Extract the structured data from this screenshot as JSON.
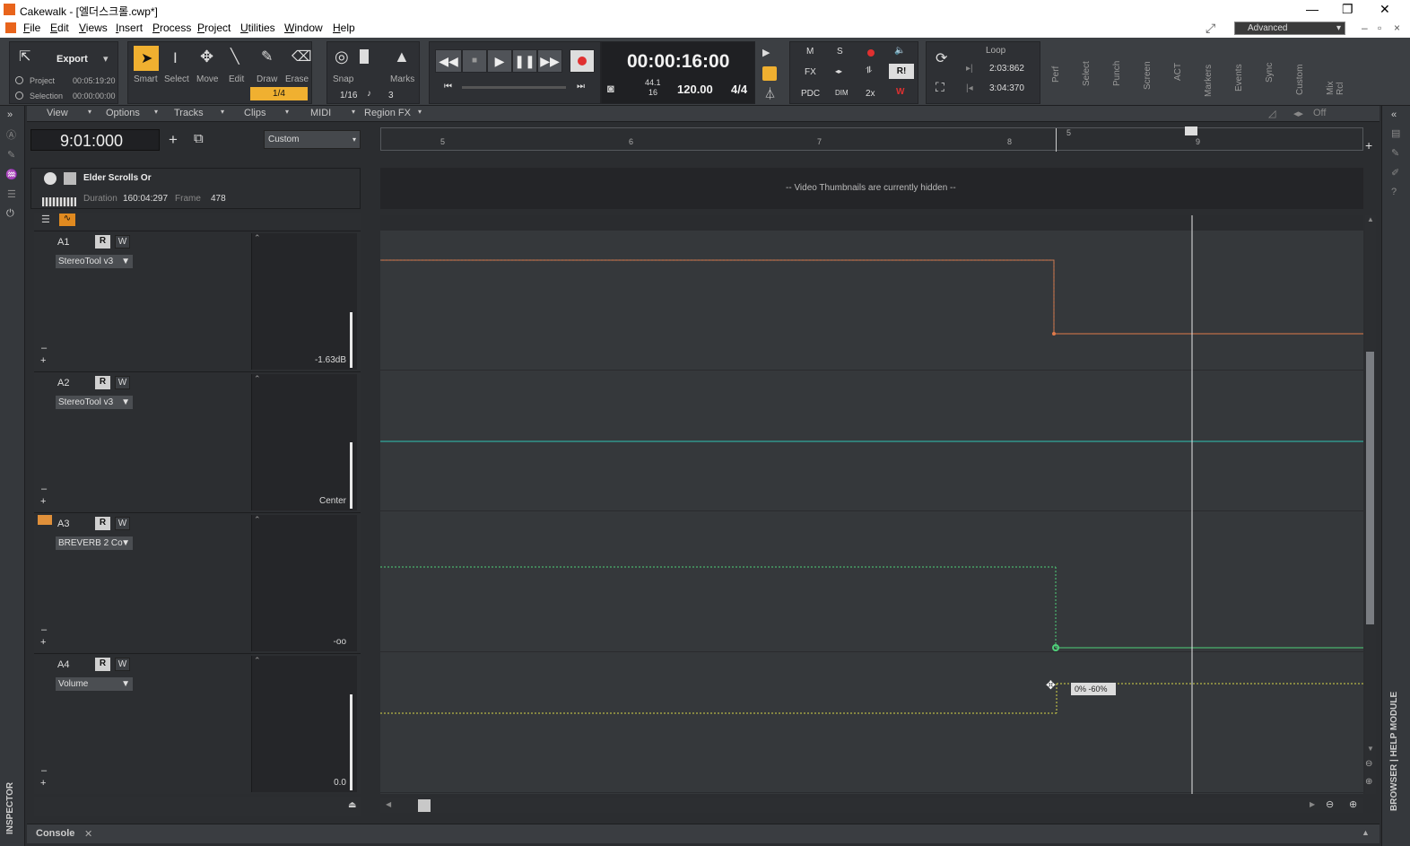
{
  "window": {
    "title": "Cakewalk - [엘더스크롤.cwp*]",
    "workspace": "Advanced"
  },
  "menu": [
    "File",
    "Edit",
    "Views",
    "Insert",
    "Process",
    "Project",
    "Utilities",
    "Window",
    "Help"
  ],
  "control": {
    "export_label": "Export",
    "project_label": "Project",
    "project_time": "00:05:19:20",
    "selection_label": "Selection",
    "selection_time": "00:00:00:00",
    "tools": [
      "Smart",
      "Select",
      "Move",
      "Edit",
      "Draw",
      "Erase"
    ],
    "tool_snap_value": "1/4",
    "snap_label": "Snap",
    "marks_label": "Marks",
    "snap_res": "1/16",
    "snap_num": "3",
    "time": "00:00:16:00",
    "sample_rate": "44.1",
    "bit_depth": "16",
    "tempo": "120.00",
    "meter": "4/4",
    "mix_buttons": [
      "M",
      "S",
      "FX",
      "PDC",
      "DIM",
      "2x",
      "R!"
    ],
    "loop_label": "Loop",
    "loop_start": "2:03:862",
    "loop_end": "3:04:370",
    "modules": [
      "Perf",
      "Select",
      "Punch",
      "Screen",
      "ACT",
      "Markers",
      "Events",
      "Sync",
      "Custom",
      "Mix Rcl"
    ]
  },
  "trackview": {
    "menus": [
      "View",
      "Options",
      "Tracks",
      "Clips",
      "MIDI",
      "Region FX"
    ],
    "now_time": "9:01:000",
    "custom_label": "Custom",
    "off_label": "Off",
    "ruler_ticks": [
      "5",
      "6",
      "7",
      "8",
      "5",
      "9"
    ],
    "video_title": "Elder Scrolls Or",
    "duration_label": "Duration",
    "duration": "160:04:297",
    "frame_label": "Frame",
    "frame": "478",
    "video_hidden_msg": "-- Video Thumbnails are currently hidden --",
    "tooltip": "0%  -60%"
  },
  "tracks": [
    {
      "id": "A1",
      "plugin": "StereoTool v3",
      "value": "-1.63dB",
      "level": 0.42
    },
    {
      "id": "A2",
      "plugin": "StereoTool v3",
      "value": "Center",
      "level": 0.5
    },
    {
      "id": "A3",
      "plugin": "BREVERB 2 Co",
      "value": "-oo",
      "level": 0
    },
    {
      "id": "A4",
      "plugin": "Volume",
      "value": "0.0",
      "level": 0.72
    }
  ],
  "footer": {
    "console_label": "Console",
    "inspector_label": "INSPECTOR",
    "browser_label": "BROWSER | HELP MODULE"
  },
  "colors": {
    "accent": "#e8641c",
    "cyan_env": "#2ec4b6",
    "green_env": "#4fd17a",
    "yellow_env": "#d6d64a",
    "orange_env": "#e07a4a"
  }
}
